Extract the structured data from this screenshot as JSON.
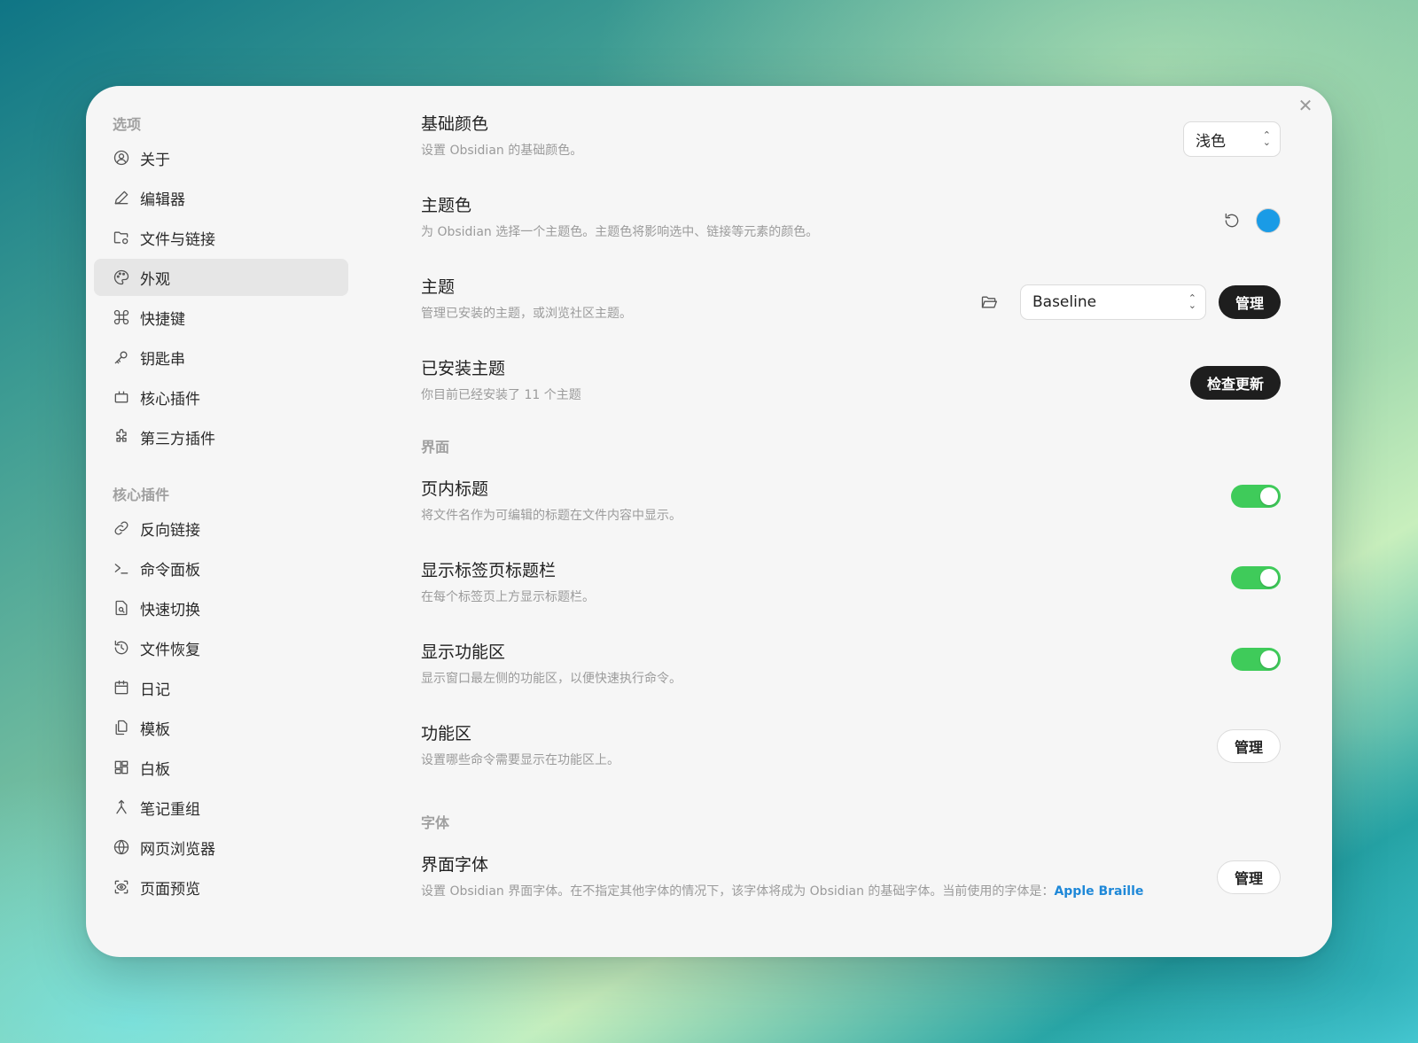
{
  "window": {
    "close_glyph": "✕"
  },
  "sidebar": {
    "group1_title": "选项",
    "group1": [
      {
        "label": "关于",
        "icon": "user-circle-icon"
      },
      {
        "label": "编辑器",
        "icon": "pencil-icon"
      },
      {
        "label": "文件与链接",
        "icon": "folder-cog-icon"
      },
      {
        "label": "外观",
        "icon": "palette-icon",
        "active": true
      },
      {
        "label": "快捷键",
        "icon": "command-icon"
      },
      {
        "label": "钥匙串",
        "icon": "key-icon"
      },
      {
        "label": "核心插件",
        "icon": "plug-icon"
      },
      {
        "label": "第三方插件",
        "icon": "puzzle-icon"
      }
    ],
    "group2_title": "核心插件",
    "group2": [
      {
        "label": "反向链接",
        "icon": "backlink-icon"
      },
      {
        "label": "命令面板",
        "icon": "terminal-icon"
      },
      {
        "label": "快速切换",
        "icon": "file-search-icon"
      },
      {
        "label": "文件恢复",
        "icon": "history-icon"
      },
      {
        "label": "日记",
        "icon": "calendar-icon"
      },
      {
        "label": "模板",
        "icon": "files-icon"
      },
      {
        "label": "白板",
        "icon": "layout-dashboard-icon"
      },
      {
        "label": "笔记重组",
        "icon": "merge-icon"
      },
      {
        "label": "网页浏览器",
        "icon": "globe-icon"
      },
      {
        "label": "页面预览",
        "icon": "scan-eye-icon"
      }
    ]
  },
  "settings": {
    "base_color": {
      "title": "基础颜色",
      "desc": "设置 Obsidian 的基础颜色。",
      "value": "浅色"
    },
    "accent_color": {
      "title": "主题色",
      "desc": "为 Obsidian 选择一个主题色。主题色将影响选中、链接等元素的颜色。",
      "color": "#1a9be6"
    },
    "theme": {
      "title": "主题",
      "desc": "管理已安装的主题，或浏览社区主题。",
      "value": "Baseline",
      "button": "管理"
    },
    "installed_themes": {
      "title": "已安装主题",
      "desc": "你目前已经安装了 11 个主题",
      "button": "检查更新"
    },
    "section_interface": "界面",
    "inline_title": {
      "title": "页内标题",
      "desc": "将文件名作为可编辑的标题在文件内容中显示。",
      "on": true
    },
    "tab_title_bar": {
      "title": "显示标签页标题栏",
      "desc": "在每个标签页上方显示标题栏。",
      "on": true
    },
    "ribbon": {
      "title": "显示功能区",
      "desc": "显示窗口最左侧的功能区，以便快速执行命令。",
      "on": true
    },
    "ribbon_config": {
      "title": "功能区",
      "desc": "设置哪些命令需要显示在功能区上。",
      "button": "管理"
    },
    "section_font": "字体",
    "interface_font": {
      "title": "界面字体",
      "desc": "设置 Obsidian 界面字体。在不指定其他字体的情况下，该字体将成为 Obsidian 的基础字体。当前使用的字体是：",
      "current_font": "Apple Braille",
      "button": "管理"
    }
  },
  "colors": {
    "toggle_on": "#3fcb5a",
    "accent": "#1a9be6",
    "link": "#1e88d8"
  }
}
